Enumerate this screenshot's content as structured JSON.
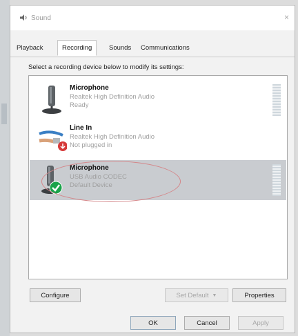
{
  "window": {
    "title": "Sound",
    "close_glyph": "×",
    "app_icon": "speaker-icon"
  },
  "tabs": [
    {
      "label": "Playback"
    },
    {
      "label": "Recording"
    },
    {
      "label": "Sounds"
    },
    {
      "label": "Communications"
    }
  ],
  "instruction": "Select a recording device below to modify its settings:",
  "devices": [
    {
      "name": "Microphone",
      "driver": "Realtek High Definition Audio",
      "status": "Ready",
      "icon": "microphone-icon"
    },
    {
      "name": "Line In",
      "driver": "Realtek High Definition Audio",
      "status": "Not plugged in",
      "icon": "line-in-jack-icon"
    },
    {
      "name": "Microphone",
      "driver": "USB Audio CODEC",
      "status": "Default Device",
      "icon": "microphone-icon",
      "badge": "default-checkmark-icon"
    }
  ],
  "buttons": {
    "configure": "Configure",
    "set_default": "Set Default",
    "set_default_arrow": "▼",
    "properties": "Properties",
    "ok": "OK",
    "cancel": "Cancel",
    "apply": "Apply"
  }
}
